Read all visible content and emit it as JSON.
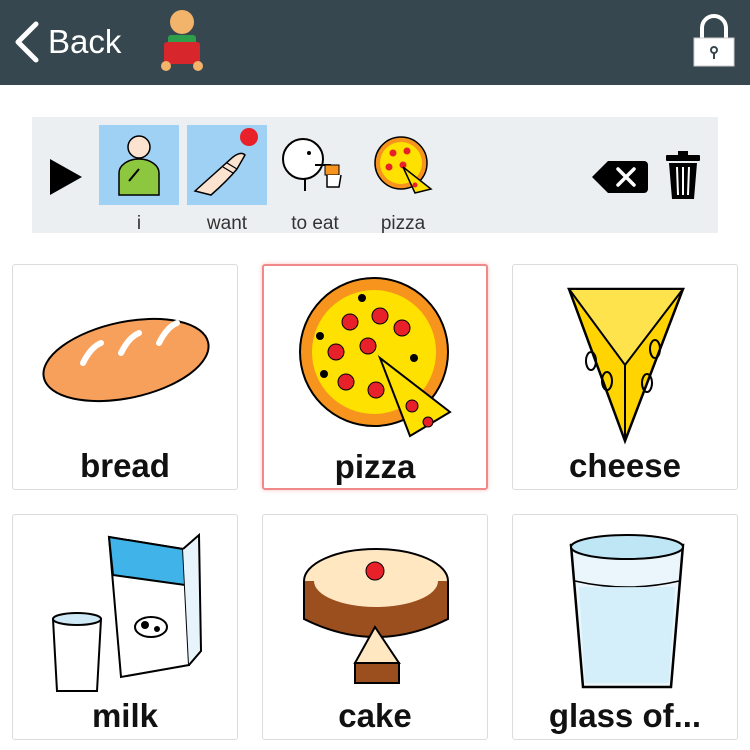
{
  "header": {
    "back_label": "Back",
    "icons": [
      "back-chevron-icon",
      "user-avatar-icon",
      "lock-icon"
    ],
    "color": "#37474f"
  },
  "sentence": {
    "words": [
      {
        "label": "i",
        "icon": "i-symbol-icon",
        "highlighted": true
      },
      {
        "label": "want",
        "icon": "want-symbol-icon",
        "highlighted": true
      },
      {
        "label": "to eat",
        "icon": "eat-symbol-icon",
        "highlighted": false
      },
      {
        "label": "pizza",
        "icon": "pizza-icon",
        "highlighted": false
      }
    ],
    "controls": [
      "play-icon",
      "backspace-icon",
      "trash-icon"
    ],
    "background": "#eceff1",
    "highlight_color": "#9fd1f5"
  },
  "grid": {
    "tiles": [
      {
        "label": "bread",
        "icon": "bread-icon",
        "selected": false
      },
      {
        "label": "pizza",
        "icon": "pizza-icon",
        "selected": true
      },
      {
        "label": "cheese",
        "icon": "cheese-icon",
        "selected": false
      },
      {
        "label": "milk",
        "icon": "milk-icon",
        "selected": false
      },
      {
        "label": "cake",
        "icon": "cake-icon",
        "selected": false
      },
      {
        "label": "glass of...",
        "icon": "glass-of-water-icon",
        "selected": false
      }
    ],
    "selected_border_color": "#f08a8a"
  }
}
